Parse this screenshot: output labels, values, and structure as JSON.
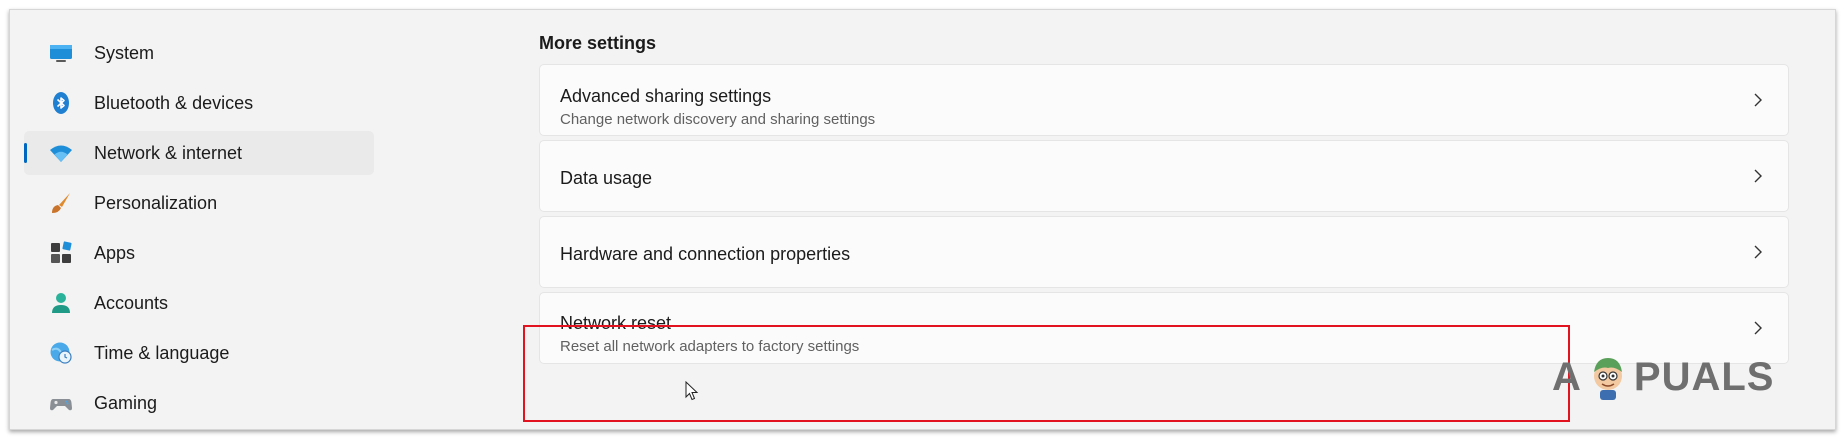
{
  "sidebar": {
    "items": [
      {
        "label": "System",
        "icon": "monitor-icon"
      },
      {
        "label": "Bluetooth & devices",
        "icon": "bluetooth-icon"
      },
      {
        "label": "Network & internet",
        "icon": "wifi-icon",
        "selected": true
      },
      {
        "label": "Personalization",
        "icon": "brush-icon"
      },
      {
        "label": "Apps",
        "icon": "apps-icon"
      },
      {
        "label": "Accounts",
        "icon": "person-icon"
      },
      {
        "label": "Time & language",
        "icon": "globe-clock-icon"
      },
      {
        "label": "Gaming",
        "icon": "gamepad-icon"
      }
    ]
  },
  "main": {
    "section_title": "More settings",
    "cards": [
      {
        "title": "Advanced sharing settings",
        "subtitle": "Change network discovery and sharing settings"
      },
      {
        "title": "Data usage",
        "subtitle": ""
      },
      {
        "title": "Hardware and connection properties",
        "subtitle": ""
      },
      {
        "title": "Network reset",
        "subtitle": "Reset all network adapters to factory settings"
      }
    ]
  },
  "watermark": {
    "left": "A",
    "right": "PUALS"
  },
  "colors": {
    "accent": "#0067c0",
    "highlight": "#e3121f",
    "window_bg": "#f3f3f3",
    "card_bg": "#fbfbfb"
  }
}
